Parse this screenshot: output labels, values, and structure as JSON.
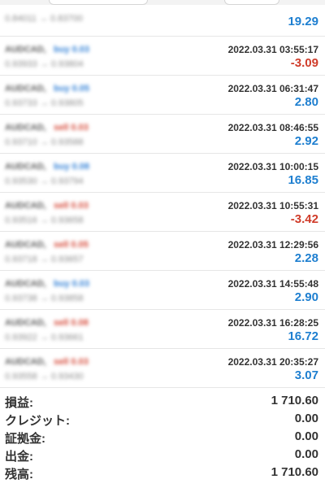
{
  "trades": [
    {
      "symbol": "",
      "side": "",
      "side_type": "",
      "prices": "0.84011 → 0.83700",
      "time": "",
      "profit": "19.29",
      "profit_sign": "pos"
    },
    {
      "symbol": "AUDCAD,",
      "side": "buy 0.03",
      "side_type": "buy",
      "prices": "0.93933 → 0.93804",
      "time": "2022.03.31 03:55:17",
      "profit": "-3.09",
      "profit_sign": "neg"
    },
    {
      "symbol": "AUDCAD,",
      "side": "buy 0.05",
      "side_type": "buy",
      "prices": "0.93733 → 0.93805",
      "time": "2022.03.31 06:31:47",
      "profit": "2.80",
      "profit_sign": "pos"
    },
    {
      "symbol": "AUDCAD,",
      "side": "sell 0.03",
      "side_type": "sell",
      "prices": "0.93710 → 0.93588",
      "time": "2022.03.31 08:46:55",
      "profit": "2.92",
      "profit_sign": "pos"
    },
    {
      "symbol": "AUDCAD,",
      "side": "buy 0.08",
      "side_type": "buy",
      "prices": "0.93530 → 0.93794",
      "time": "2022.03.31 10:00:15",
      "profit": "16.85",
      "profit_sign": "pos"
    },
    {
      "symbol": "AUDCAD,",
      "side": "sell 0.03",
      "side_type": "sell",
      "prices": "0.93516 → 0.93658",
      "time": "2022.03.31 10:55:31",
      "profit": "-3.42",
      "profit_sign": "neg"
    },
    {
      "symbol": "AUDCAD,",
      "side": "sell 0.05",
      "side_type": "sell",
      "prices": "0.93718 → 0.93657",
      "time": "2022.03.31 12:29:56",
      "profit": "2.28",
      "profit_sign": "pos"
    },
    {
      "symbol": "AUDCAD,",
      "side": "buy 0.03",
      "side_type": "buy",
      "prices": "0.93738 → 0.93858",
      "time": "2022.03.31 14:55:48",
      "profit": "2.90",
      "profit_sign": "pos"
    },
    {
      "symbol": "AUDCAD,",
      "side": "sell 0.08",
      "side_type": "sell",
      "prices": "0.93922 → 0.93661",
      "time": "2022.03.31 16:28:25",
      "profit": "16.72",
      "profit_sign": "pos"
    },
    {
      "symbol": "AUDCAD,",
      "side": "sell 0.03",
      "side_type": "sell",
      "prices": "0.93558 → 0.93430",
      "time": "2022.03.31 20:35:27",
      "profit": "3.07",
      "profit_sign": "pos"
    }
  ],
  "summary": [
    {
      "label": "損益:",
      "value": "1 710.60"
    },
    {
      "label": "クレジット:",
      "value": "0.00"
    },
    {
      "label": "証拠金:",
      "value": "0.00"
    },
    {
      "label": "出金:",
      "value": "0.00"
    },
    {
      "label": "残高:",
      "value": "1 710.60"
    }
  ],
  "colors": {
    "buy": "#2f7fd6",
    "sell": "#d64a3a",
    "profit_pos": "#1e7fd0",
    "profit_neg": "#d03c2a"
  }
}
